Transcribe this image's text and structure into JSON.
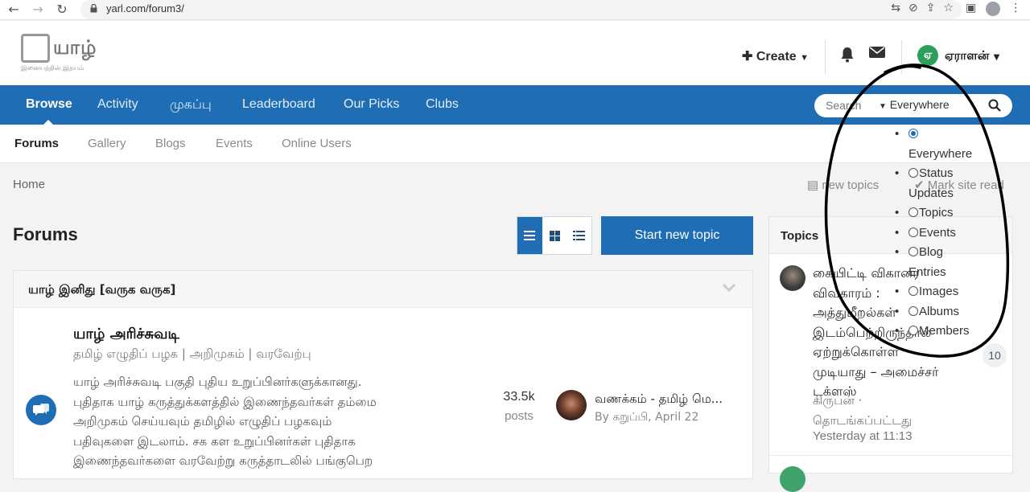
{
  "browser": {
    "url": "yarl.com/forum3/"
  },
  "header": {
    "logo_text": "யாழ்",
    "logo_sub": "இனையத்தின் இதயம்",
    "create_label": "Create",
    "user_initial": "ஏ",
    "user_name": "ஏராளன்"
  },
  "nav": {
    "items": [
      "Browse",
      "Activity",
      "முகப்பு",
      "Leaderboard",
      "Our Picks",
      "Clubs"
    ],
    "search_placeholder": "Search",
    "search_scope": "Everywhere"
  },
  "subnav": {
    "items": [
      "Forums",
      "Gallery",
      "Blogs",
      "Events",
      "Online Users"
    ]
  },
  "breadcrumb": {
    "home": "Home",
    "new_topics": "new topics",
    "mark_read": "Mark site read"
  },
  "main": {
    "title": "Forums",
    "start_button": "Start new topic",
    "category": {
      "title": "யாழ் இனிது [வருக வருக]",
      "forum": {
        "name": "யாழ் அரிச்சுவடி",
        "subtitle": "தமிழ் எழுதிப் பழக | அறிமுகம் | வரவேற்பு",
        "description_lines": [
          "யாழ் அரிச்சுவடி பகுதி புதிய உறுப்பினர்களுக்கானது.",
          "புதிதாக யாழ் கருத்துக்களத்தில் இணைந்தவர்கள் தம்மை",
          "அறிமுகம் செய்யவும் தமிழில் எழுதிப் பழகவும்",
          "பதிவுகளை இடலாம். சக கள உறுப்பினர்கள் புதிதாக",
          "இணைந்தவர்களை வரவேற்று கருத்தாடலில் பங்குபெற"
        ],
        "posts_count": "33.5k",
        "posts_label": "posts",
        "last_post_title": "வணக்கம் - தமிழ் மெ...",
        "last_post_meta": "By கறுப்பி, April 22"
      }
    }
  },
  "sidebar": {
    "title": "Topics",
    "topic": {
      "title_lines": [
        "கையிட்டி விகாரை",
        "விவகாரம் :",
        "அத்துமீறல்கள்",
        "இடம்பெற்றிருந்தால்",
        "ஏற்றுக்கொள்ள",
        "முடியாது – அமைச்சர்",
        "டக்ளஸ்"
      ],
      "by_lines": [
        "கிருபன் ·",
        "தொடங்கப்பட்டது"
      ],
      "time": "Yesterday at 11:13",
      "count": "10"
    }
  },
  "dropdown": {
    "lines": [
      {
        "radio": "on",
        "text": "",
        "bullet": true
      },
      {
        "radio": "",
        "text": "Everywhere",
        "bullet": false
      },
      {
        "radio": "off",
        "text": "Status",
        "bullet": true
      },
      {
        "radio": "",
        "text": "Updates",
        "bullet": false
      },
      {
        "radio": "off",
        "text": "Topics",
        "bullet": true
      },
      {
        "radio": "off",
        "text": "Events",
        "bullet": true
      },
      {
        "radio": "off",
        "text": "Blog",
        "bullet": true
      },
      {
        "radio": "",
        "text": "Entries",
        "bullet": false
      },
      {
        "radio": "off",
        "text": "Images",
        "bullet": true
      },
      {
        "radio": "off",
        "text": "Albums",
        "bullet": true
      },
      {
        "radio": "off",
        "text": "Members",
        "bullet": true
      }
    ]
  },
  "colors": {
    "brand_blue": "#1f6eb5",
    "user_green": "#2e9e5b"
  }
}
